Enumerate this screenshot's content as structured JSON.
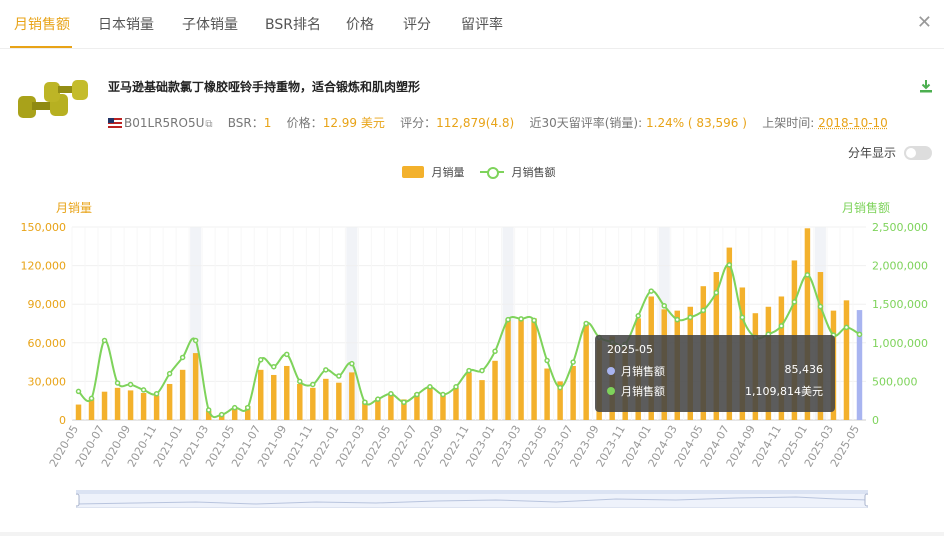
{
  "tabs": [
    "月销售额",
    "日本销量",
    "子体销量",
    "BSR排名",
    "价格",
    "评分",
    "留评率"
  ],
  "active_tab": 0,
  "product": {
    "title": "亚马逊基础款氯丁橡胶哑铃手持重物，适合锻炼和肌肉塑形",
    "asin": "B01LR5RO5U",
    "bsr_label": "BSR：",
    "bsr": "1",
    "price_label": "价格：",
    "price": "12.99 美元",
    "rating_label": "评分：",
    "rating": "112,879(4.8)",
    "rate30_label": "近30天留评率(销量):",
    "rate30": "1.24% ( 83,596 )",
    "launch_label": "上架时间:",
    "launch": "2018-10-10"
  },
  "toggle_label": "分年显示",
  "colors": {
    "bar": "#f3b12c",
    "line": "#7ed35b",
    "accent": "#e8a317",
    "highlight": "#a8b4f0"
  },
  "chart_data": {
    "type": "bar+line",
    "legend": [
      "月销量",
      "月销售额"
    ],
    "y_left_label": "月销量",
    "y_right_label": "月销售额",
    "y_left_ticks": [
      "150,000",
      "120,000",
      "90,000",
      "60,000",
      "30,000",
      "0"
    ],
    "y_right_ticks": [
      "2,500,000",
      "2,000,000",
      "1,500,000",
      "1,000,000",
      "500,000",
      "0"
    ],
    "y_left_lim": [
      0,
      150000
    ],
    "y_right_lim": [
      0,
      2500000
    ],
    "x_tick_labels": [
      "2020-05",
      "2020-07",
      "2020-09",
      "2020-11",
      "2021-01",
      "2021-03",
      "2021-05",
      "2021-07",
      "2021-09",
      "2021-11",
      "2022-01",
      "2022-03",
      "2022-05",
      "2022-07",
      "2022-09",
      "2022-11",
      "2023-01",
      "2023-03",
      "2023-05",
      "2023-07",
      "2023-09",
      "2023-11",
      "2024-01",
      "2024-03",
      "2024-05",
      "2024-07",
      "2024-09",
      "2024-11",
      "2025-01",
      "2025-03",
      "2025-05"
    ],
    "categories": [
      "2020-05",
      "2020-06",
      "2020-07",
      "2020-08",
      "2020-09",
      "2020-10",
      "2020-11",
      "2020-12",
      "2021-01",
      "2021-02",
      "2021-03",
      "2021-04",
      "2021-05",
      "2021-06",
      "2021-07",
      "2021-08",
      "2021-09",
      "2021-10",
      "2021-11",
      "2021-12",
      "2022-01",
      "2022-02",
      "2022-03",
      "2022-04",
      "2022-05",
      "2022-06",
      "2022-07",
      "2022-08",
      "2022-09",
      "2022-10",
      "2022-11",
      "2022-12",
      "2023-01",
      "2023-02",
      "2023-03",
      "2023-04",
      "2023-05",
      "2023-06",
      "2023-07",
      "2023-08",
      "2023-09",
      "2023-10",
      "2023-11",
      "2023-12",
      "2024-01",
      "2024-02",
      "2024-03",
      "2024-04",
      "2024-05",
      "2024-06",
      "2024-07",
      "2024-08",
      "2024-09",
      "2024-10",
      "2024-11",
      "2024-12",
      "2025-01",
      "2025-02",
      "2025-03",
      "2025-04",
      "2025-05"
    ],
    "series": [
      {
        "name": "月销量",
        "type": "bar",
        "values": [
          12000,
          17000,
          22000,
          25000,
          23000,
          21000,
          19000,
          28000,
          39000,
          52000,
          7000,
          5000,
          9000,
          11000,
          39000,
          35000,
          42000,
          28000,
          25000,
          32000,
          29000,
          37000,
          15000,
          17000,
          21000,
          16000,
          21000,
          25000,
          20000,
          25000,
          37000,
          31000,
          46000,
          78000,
          79000,
          79000,
          40000,
          30000,
          42000,
          74000,
          62000,
          65000,
          58000,
          79000,
          96000,
          86000,
          85000,
          88000,
          104000,
          115000,
          134000,
          103000,
          83000,
          88000,
          96000,
          124000,
          149000,
          115000,
          85000,
          93000,
          85436
        ]
      },
      {
        "name": "月销售额",
        "type": "line",
        "values": [
          370000,
          280000,
          1030000,
          480000,
          460000,
          390000,
          340000,
          600000,
          810000,
          1030000,
          130000,
          70000,
          160000,
          160000,
          780000,
          690000,
          850000,
          500000,
          460000,
          650000,
          570000,
          730000,
          230000,
          270000,
          340000,
          230000,
          330000,
          430000,
          330000,
          430000,
          640000,
          640000,
          890000,
          1300000,
          1310000,
          1290000,
          770000,
          420000,
          750000,
          1250000,
          1070000,
          1010000,
          980000,
          1350000,
          1670000,
          1480000,
          1300000,
          1330000,
          1420000,
          1650000,
          2010000,
          1330000,
          1070000,
          1110000,
          1220000,
          1530000,
          1880000,
          1470000,
          1100000,
          1200000,
          1109814
        ]
      }
    ],
    "tooltip": {
      "title": "2025-05",
      "rows": [
        {
          "name": "月销售额",
          "value": "85,436",
          "color": "#a8b4f0"
        },
        {
          "name": "月销售额",
          "value": "1,109,814美元",
          "color": "#7ed35b"
        }
      ]
    }
  }
}
